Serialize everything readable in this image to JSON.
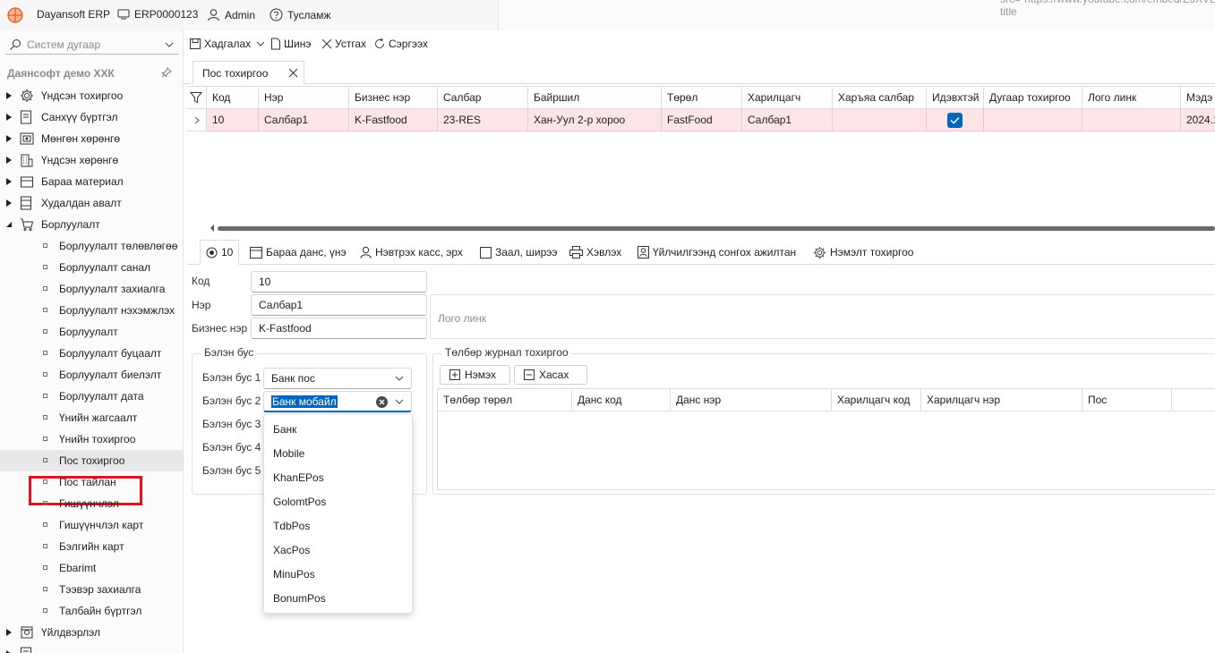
{
  "titlebar": {
    "app_name": "Dayansoft ERP",
    "code": "ERP0000123",
    "user": "Admin",
    "help": "Тусламж",
    "background_text": "src=\"https://www.youtube.com/embed/Z6XVLFGTIadE\" title"
  },
  "sidebar": {
    "search_placeholder": "Систем дугаар",
    "company": "Даянсофт демо ХХК",
    "items": [
      {
        "label": "Үндсэн тохиргоо",
        "icon": "gear-icon"
      },
      {
        "label": "Санхүү бүртгэл",
        "icon": "ledger-icon"
      },
      {
        "label": "Мөнгөн хөрөнгө",
        "icon": "cash-icon"
      },
      {
        "label": "Үндсэн хөрөнгө",
        "icon": "building-icon"
      },
      {
        "label": "Бараа материал",
        "icon": "box-icon"
      },
      {
        "label": "Худалдан авалт",
        "icon": "purchase-icon"
      },
      {
        "label": "Борлуулалт",
        "icon": "cart-icon"
      }
    ],
    "sales_children": [
      "Борлуулалт төлөвлөгөө",
      "Борлуулалт санал",
      "Борлуулалт захиалга",
      "Борлуулалт нэхэмжлэх",
      "Борлуулалт",
      "Борлуулалт буцаалт",
      "Борлуулалт биелэлт",
      "Борлуулалт дата",
      "Үнийн жагсаалт",
      "Үнийн тохиргоо",
      "Пос тохиргоо",
      "Пос тайлан",
      "Гишүүнчлэл",
      "Гишүүнчлэл карт",
      "Бэлгийн карт",
      "Ebarimt",
      "Тээвэр захиалга",
      "Талбайн бүртгэл"
    ],
    "after_items": [
      {
        "label": "Үйлдвэрлэл",
        "icon": "factory-icon"
      }
    ]
  },
  "toolbar": {
    "save": "Хадгалах",
    "new": "Шинэ",
    "delete": "Устгах",
    "refresh": "Сэргээх"
  },
  "doc_tab": {
    "label": "Пос тохиргоо"
  },
  "grid": {
    "columns": [
      "Код",
      "Нэр",
      "Бизнес нэр",
      "Салбар",
      "Байршил",
      "Төрөл",
      "Харилцагч",
      "Харъяа салбар",
      "Идэвхтэй",
      "Дугаар тохиргоо",
      "Лого линк",
      "Мэдэ"
    ],
    "row": {
      "code": "10",
      "name": "Салбар1",
      "business": "K-Fastfood",
      "branch": "23-RES",
      "location": "Хан-Уул 2-р хороо",
      "type": "FastFood",
      "partner": "Салбар1",
      "parent_branch": "",
      "active": true,
      "numbering": "",
      "logo": "",
      "date": "2024.1"
    }
  },
  "detail_tabs": [
    {
      "label": "10",
      "icon": "radio-icon"
    },
    {
      "label": "Бараа данс, үнэ",
      "icon": "table-icon"
    },
    {
      "label": "Нэвтрэх касс, эрх",
      "icon": "user-icon"
    },
    {
      "label": "Заал, ширээ",
      "icon": "square-icon"
    },
    {
      "label": "Хэвлэх",
      "icon": "printer-icon"
    },
    {
      "label": "Үйлчилгээнд сонгох ажилтан",
      "icon": "person-card-icon"
    },
    {
      "label": "Нэмэлт тохиргоо",
      "icon": "gear-icon"
    }
  ],
  "form": {
    "code_label": "Код",
    "code_value": "10",
    "name_label": "Нэр",
    "name_value": "Салбар1",
    "business_label": "Бизнес нэр",
    "business_value": "K-Fastfood",
    "logo_placeholder": "Лого линк"
  },
  "cash_group": {
    "title": "Бэлэн бус",
    "labels": [
      "Бэлэн бус 1",
      "Бэлэн бус 2",
      "Бэлэн бус 3",
      "Бэлэн бус 4",
      "Бэлэн бус 5"
    ],
    "value1": "Банк пос",
    "value2": "Банк мобайл"
  },
  "dropdown": {
    "options": [
      "Банк",
      "Mobile",
      "KhanEPos",
      "GolomtPos",
      "TdbPos",
      "XacPos",
      "MinuPos",
      "BonumPos"
    ]
  },
  "payment_group": {
    "title": "Төлбөр журнал тохиргоо",
    "add": "Нэмэх",
    "remove": "Хасах",
    "columns": [
      "Төлбөр төрөл",
      "Данс код",
      "Данс нэр",
      "Харилцагч код",
      "Харилцагч нэр",
      "Пос"
    ]
  },
  "colors": {
    "accent": "#0067c0",
    "selected_row": "#fde4e6",
    "highlight_border": "#e0141e"
  }
}
